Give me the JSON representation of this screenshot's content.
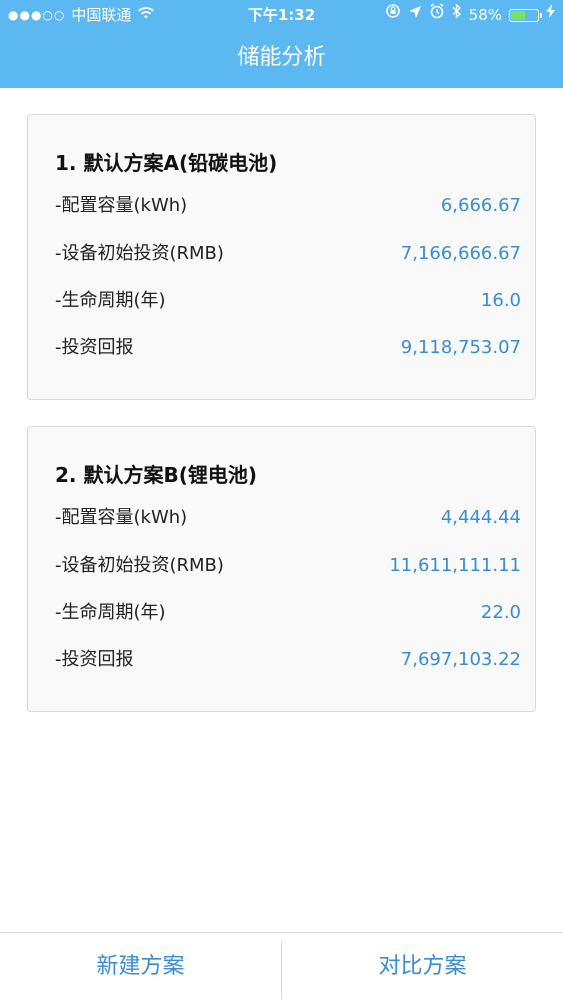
{
  "status_bar": {
    "signal": "●●●○○",
    "carrier": "中国联通",
    "time": "下午1:32",
    "battery_percent": "58%",
    "battery_level": 0.58,
    "battery_color": "#7be060"
  },
  "nav": {
    "title": "储能分析"
  },
  "plans": [
    {
      "title": "1. 默认方案A(铅碳电池)",
      "rows": [
        {
          "label": "-配置容量(kWh)",
          "value": "6,666.67"
        },
        {
          "label": "-设备初始投资(RMB)",
          "value": "7,166,666.67"
        },
        {
          "label": "-生命周期(年)",
          "value": "16.0"
        },
        {
          "label": "-投资回报",
          "value": "9,118,753.07"
        }
      ]
    },
    {
      "title": "2. 默认方案B(锂电池)",
      "rows": [
        {
          "label": "-配置容量(kWh)",
          "value": "4,444.44"
        },
        {
          "label": "-设备初始投资(RMB)",
          "value": "11,611,111.11"
        },
        {
          "label": "-生命周期(年)",
          "value": "22.0"
        },
        {
          "label": "-投资回报",
          "value": "7,697,103.22"
        }
      ]
    }
  ],
  "toolbar": {
    "new_plan": "新建方案",
    "compare_plan": "对比方案"
  },
  "colors": {
    "header_bg": "#5bb8f0",
    "value_text": "#3a8dd0",
    "card_bg": "#f9f9fa",
    "card_border": "#d9d9de"
  },
  "icons": [
    "wifi-icon",
    "rotation-lock-icon",
    "location-arrow-icon",
    "alarm-icon",
    "bluetooth-icon",
    "battery-icon",
    "charging-bolt-icon"
  ]
}
